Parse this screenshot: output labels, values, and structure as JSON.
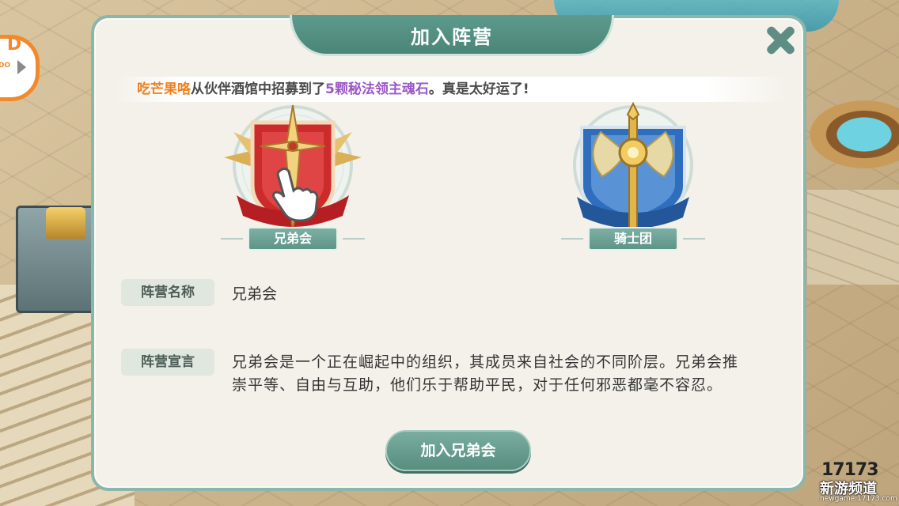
{
  "side_logo": {
    "text": "D",
    "sub": "DO"
  },
  "dialog": {
    "title": "加入阵营",
    "notice": {
      "player": "吃芒果咯",
      "text1": "从伙伴酒馆中招募到了",
      "count": "5颗",
      "item": "秘法领主魂石",
      "text2": "。真是太好运了!"
    },
    "factions": [
      {
        "name": "兄弟会",
        "selected": true,
        "color": "#c92b2b"
      },
      {
        "name": "骑士团",
        "selected": false,
        "color": "#2c6fc0"
      }
    ],
    "faction_name_label": "阵营名称",
    "faction_name_value": "兄弟会",
    "declaration_label": "阵营宣言",
    "declaration_value": "兄弟会是一个正在崛起中的组织，其成员来自社会的不同阶层。兄弟会推崇平等、自由与互助，他们乐于帮助平民，对于任何邪恶都毫不容忍。",
    "join_button": "加入兄弟会"
  },
  "watermark": {
    "logo": "17173",
    "cn": "新游频道",
    "url": "newgame.17173.com"
  }
}
